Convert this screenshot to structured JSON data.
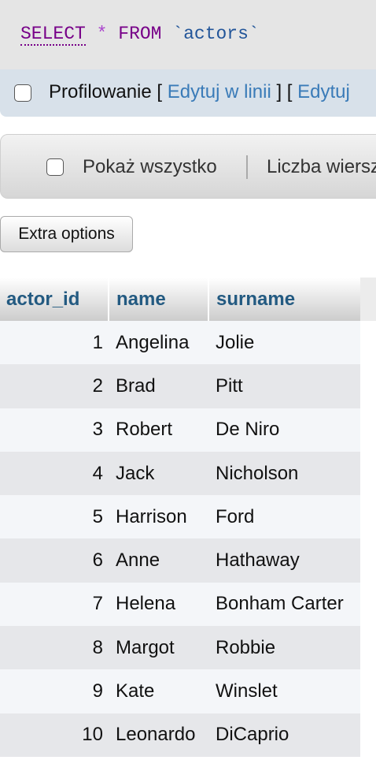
{
  "sql": {
    "select": "SELECT",
    "star": "*",
    "from": "FROM",
    "table": "`actors`"
  },
  "profiling": {
    "label": "Profilowanie",
    "open_bracket": " [ ",
    "edit_inline": "Edytuj w linii",
    "mid_bracket": " ] [ ",
    "edit": "Edytuj"
  },
  "nav": {
    "show_all": "Pokaż wszystko",
    "rows_label": "Liczba wierszy"
  },
  "extra_options_label": "Extra options",
  "table": {
    "columns": [
      "actor_id",
      "name",
      "surname"
    ],
    "rows": [
      {
        "id": "1",
        "name": "Angelina",
        "surname": "Jolie"
      },
      {
        "id": "2",
        "name": "Brad",
        "surname": "Pitt"
      },
      {
        "id": "3",
        "name": "Robert",
        "surname": "De Niro"
      },
      {
        "id": "4",
        "name": "Jack",
        "surname": "Nicholson"
      },
      {
        "id": "5",
        "name": "Harrison",
        "surname": "Ford"
      },
      {
        "id": "6",
        "name": "Anne",
        "surname": "Hathaway"
      },
      {
        "id": "7",
        "name": "Helena",
        "surname": "Bonham Carter"
      },
      {
        "id": "8",
        "name": "Margot",
        "surname": "Robbie"
      },
      {
        "id": "9",
        "name": "Kate",
        "surname": "Winslet"
      },
      {
        "id": "10",
        "name": "Leonardo",
        "surname": "DiCaprio"
      }
    ]
  }
}
